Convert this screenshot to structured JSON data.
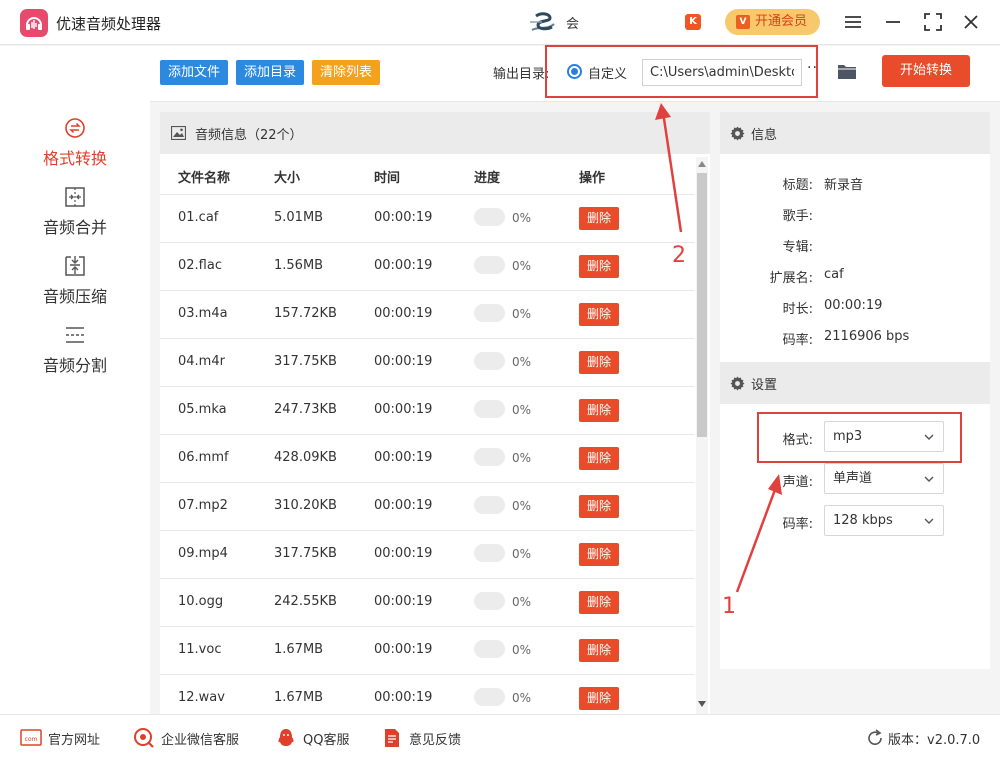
{
  "app": {
    "title": "优速音频处理器",
    "user_name": "会",
    "vip_label": "开通会员",
    "hot_badge": "K"
  },
  "sidebar": {
    "items": [
      {
        "label": "格式转换",
        "active": true
      },
      {
        "label": "音频合并",
        "active": false
      },
      {
        "label": "音频压缩",
        "active": false
      },
      {
        "label": "音频分割",
        "active": false
      }
    ]
  },
  "toolbar": {
    "add_file": "添加文件",
    "add_dir": "添加目录",
    "clear_list": "清除列表",
    "output_label": "输出目录:",
    "custom_label": "自定义",
    "output_path": "C:\\Users\\admin\\Deskto",
    "more": "··",
    "start": "开始转换"
  },
  "filelist": {
    "title": "音频信息（22个）",
    "columns": [
      "文件名称",
      "大小",
      "时间",
      "进度",
      "操作"
    ],
    "delete_label": "删除",
    "rows": [
      {
        "name": "01.caf",
        "size": "5.01MB",
        "time": "00:00:19",
        "progress": "0%",
        "progress_value": 0
      },
      {
        "name": "02.flac",
        "size": "1.56MB",
        "time": "00:00:19",
        "progress": "0%",
        "progress_value": 0
      },
      {
        "name": "03.m4a",
        "size": "157.72KB",
        "time": "00:00:19",
        "progress": "0%",
        "progress_value": 0
      },
      {
        "name": "04.m4r",
        "size": "317.75KB",
        "time": "00:00:19",
        "progress": "0%",
        "progress_value": 0
      },
      {
        "name": "05.mka",
        "size": "247.73KB",
        "time": "00:00:19",
        "progress": "0%",
        "progress_value": 0
      },
      {
        "name": "06.mmf",
        "size": "428.09KB",
        "time": "00:00:19",
        "progress": "0%",
        "progress_value": 0
      },
      {
        "name": "07.mp2",
        "size": "310.20KB",
        "time": "00:00:19",
        "progress": "0%",
        "progress_value": 0
      },
      {
        "name": "09.mp4",
        "size": "317.75KB",
        "time": "00:00:19",
        "progress": "0%",
        "progress_value": 0
      },
      {
        "name": "10.ogg",
        "size": "242.55KB",
        "time": "00:00:19",
        "progress": "0%",
        "progress_value": 0
      },
      {
        "name": "11.voc",
        "size": "1.67MB",
        "time": "00:00:19",
        "progress": "0%",
        "progress_value": 0
      },
      {
        "name": "12.wav",
        "size": "1.67MB",
        "time": "00:00:19",
        "progress": "0%",
        "progress_value": 0
      }
    ]
  },
  "info": {
    "title": "信息",
    "fields": [
      {
        "label": "标题:",
        "value": "新录音"
      },
      {
        "label": "歌手:",
        "value": ""
      },
      {
        "label": "专辑:",
        "value": ""
      },
      {
        "label": "扩展名:",
        "value": "caf"
      },
      {
        "label": "时长:",
        "value": "00:00:19"
      },
      {
        "label": "码率:",
        "value": "2116906 bps"
      }
    ]
  },
  "settings": {
    "title": "设置",
    "format_label": "格式:",
    "format_value": "mp3",
    "channel_label": "声道:",
    "channel_value": "单声道",
    "bitrate_label": "码率:",
    "bitrate_value": "128 kbps"
  },
  "annotations": {
    "marker_1": "1",
    "marker_2": "2",
    "color": "#e0413e"
  },
  "footer": {
    "website": "官方网址",
    "wechat": "企业微信客服",
    "qq": "QQ客服",
    "feedback": "意见反馈",
    "version": "版本：v2.0.7.0",
    "com_badge": "com"
  }
}
